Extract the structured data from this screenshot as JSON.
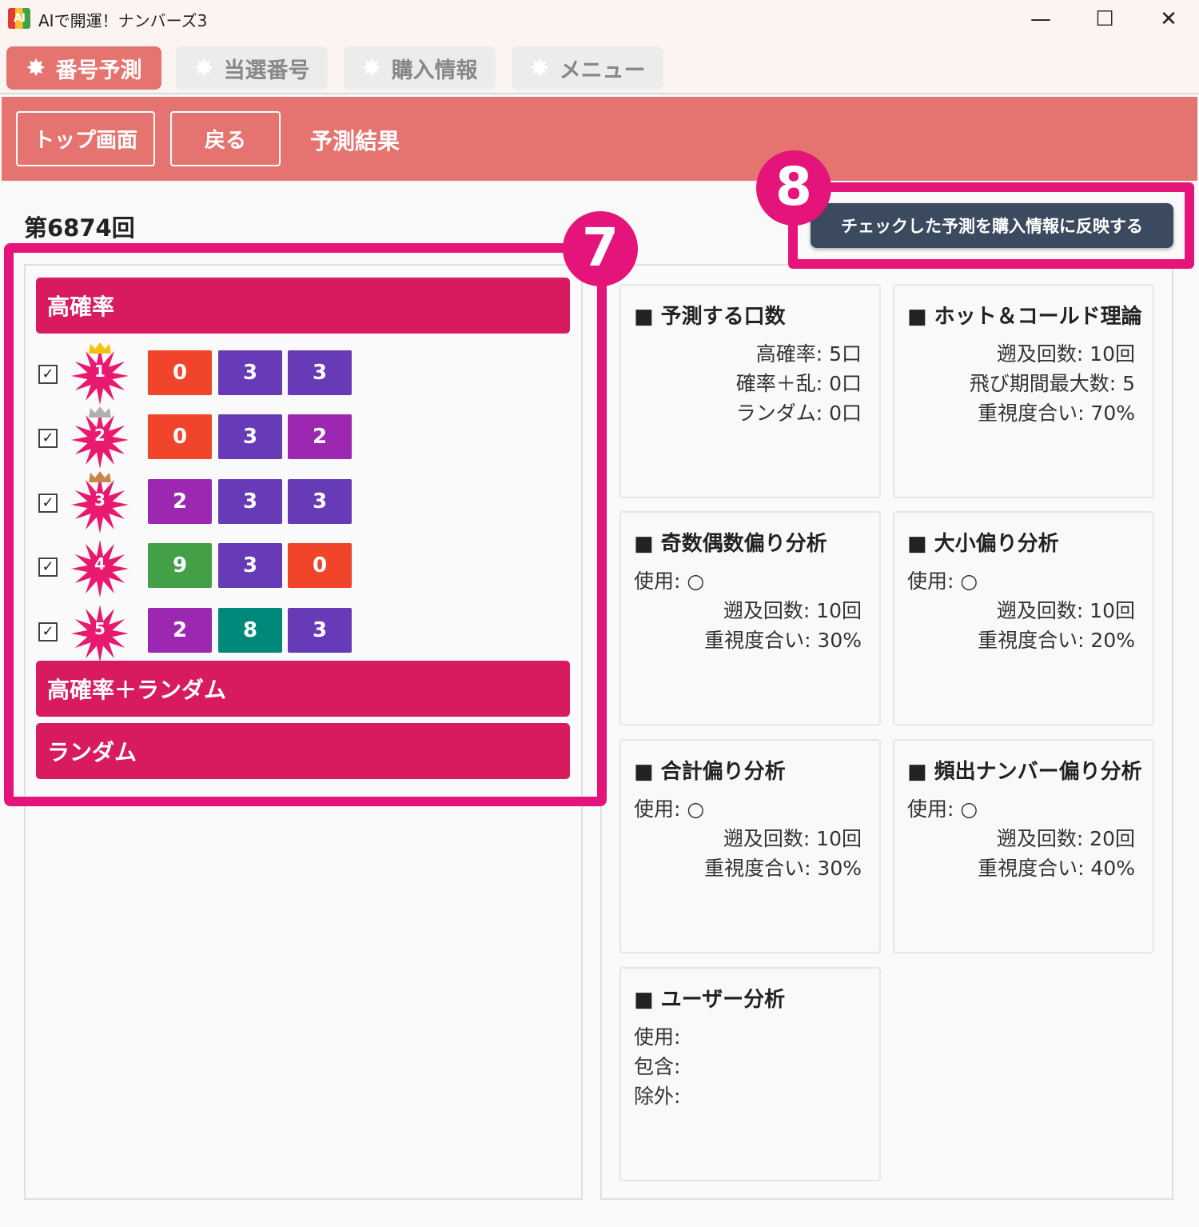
{
  "window": {
    "title": "AIで開運！ナンバーズ3",
    "logo_text": "AI",
    "min": "—",
    "max": "☐",
    "close": "✕"
  },
  "tabs": [
    {
      "label": "番号予測",
      "active": true
    },
    {
      "label": "当選番号",
      "active": false
    },
    {
      "label": "購入情報",
      "active": false
    },
    {
      "label": "メニュー",
      "active": false
    }
  ],
  "tab_star": "✸",
  "header": {
    "top_button": "トップ画面",
    "back_button": "戻る",
    "title": "予測結果"
  },
  "round_label": "第6874回",
  "reflect_button": "チェックした予測を購入情報に反映する",
  "categories": [
    "高確率",
    "高確率＋ランダム",
    "ランダム"
  ],
  "predictions": [
    {
      "rank": "1",
      "checked": "✓",
      "digits": [
        "0",
        "3",
        "3"
      ],
      "colors": [
        "#f0452a",
        "#673ab7",
        "#673ab7"
      ],
      "crown": "#f4c20d"
    },
    {
      "rank": "2",
      "checked": "✓",
      "digits": [
        "0",
        "3",
        "2"
      ],
      "colors": [
        "#f0452a",
        "#673ab7",
        "#9c27b0"
      ],
      "crown": "#b0b0b0"
    },
    {
      "rank": "3",
      "checked": "✓",
      "digits": [
        "2",
        "3",
        "3"
      ],
      "colors": [
        "#9c27b0",
        "#673ab7",
        "#673ab7"
      ],
      "crown": "#c8874a"
    },
    {
      "rank": "4",
      "checked": "✓",
      "digits": [
        "9",
        "3",
        "0"
      ],
      "colors": [
        "#43a047",
        "#673ab7",
        "#f0452a"
      ],
      "crown": ""
    },
    {
      "rank": "5",
      "checked": "✓",
      "digits": [
        "2",
        "8",
        "3"
      ],
      "colors": [
        "#9c27b0",
        "#00897b",
        "#673ab7"
      ],
      "crown": ""
    }
  ],
  "cards": {
    "count": {
      "title": "■ 予測する口数",
      "lines": [
        "高確率: 5口",
        "確率＋乱: 0口",
        "ランダム: 0口"
      ]
    },
    "hotcold": {
      "title": "■ ホット＆コールド理論",
      "lines": [
        "遡及回数: 10回",
        "飛び期間最大数: 5",
        "重視度合い: 70%"
      ]
    },
    "oddeven": {
      "title": "■ 奇数偶数偏り分析",
      "use": "使用: ○",
      "lines": [
        "遡及回数: 10回",
        "重視度合い: 30%"
      ]
    },
    "bigsmall": {
      "title": "■ 大小偏り分析",
      "use": "使用: ○",
      "lines": [
        "遡及回数: 10回",
        "重視度合い: 20%"
      ]
    },
    "sum": {
      "title": "■ 合計偏り分析",
      "use": "使用: ○",
      "lines": [
        "遡及回数: 10回",
        "重視度合い: 30%"
      ]
    },
    "freq": {
      "title": "■  頻出ナンバー偏り分析",
      "use": "使用: ○",
      "lines": [
        "遡及回数: 20回",
        "重視度合い: 40%"
      ]
    },
    "user": {
      "title": "■ ユーザー分析",
      "lines": [
        "使用:",
        "包含:",
        "除外:"
      ]
    }
  },
  "annotations": {
    "box7": "7",
    "box8": "8"
  },
  "colors": {
    "accent": "#e57470",
    "category": "#d81b5e",
    "annotation": "#e5147b",
    "burst": "#e8196e",
    "button_dark": "#3b4a5e"
  }
}
